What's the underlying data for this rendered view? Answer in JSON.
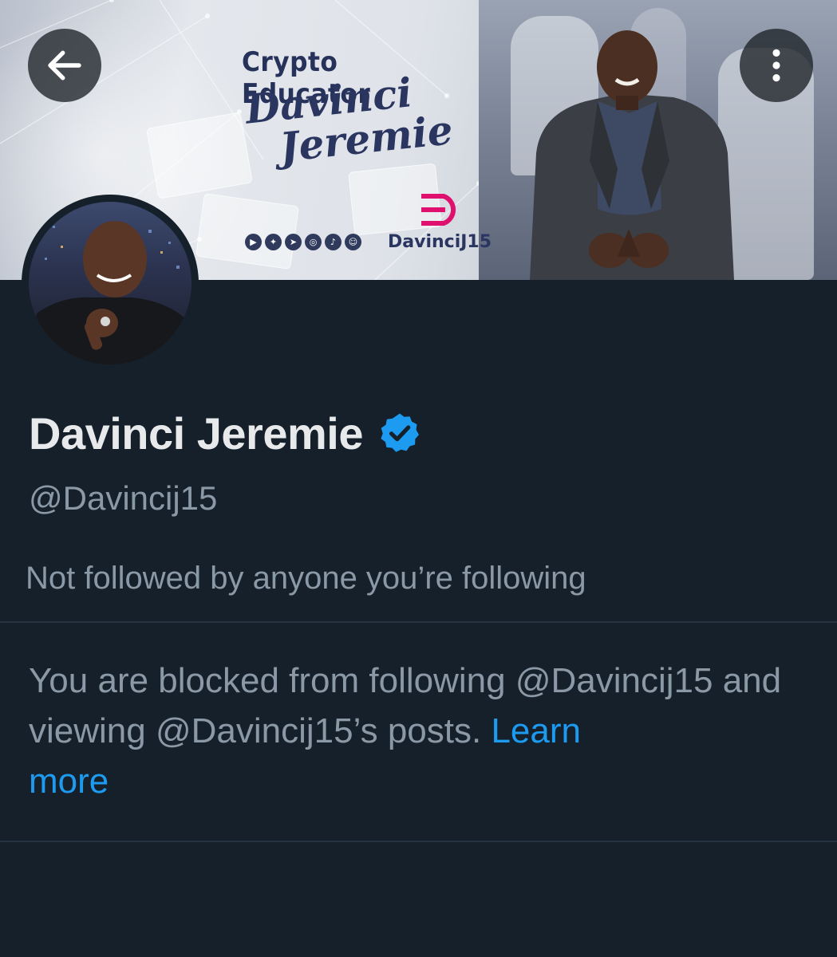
{
  "banner": {
    "title": "Crypto Educator",
    "script_line1": "Davinci",
    "script_line2": "Jeremie",
    "handle": "DavinciJ15",
    "social_icons": [
      "youtube-icon",
      "twitter-icon",
      "telegram-icon",
      "instagram-icon",
      "tiktok-icon",
      "discord-icon"
    ]
  },
  "nav": {
    "back_icon": "arrow-left-icon",
    "more_icon": "more-vertical-icon"
  },
  "profile": {
    "display_name": "Davinci Jeremie",
    "verified": true,
    "handle": "@Davincij15",
    "followed_by_text": "Not followed by anyone you’re following"
  },
  "blocked": {
    "message": "You are blocked from following @Davincij15 and viewing @Davincij15’s posts.",
    "link_label_1": "Learn",
    "link_label_2": "more"
  },
  "colors": {
    "background": "#15202b",
    "primary_text": "#e7e9ea",
    "secondary_text": "#8b98a5",
    "link": "#1d9bf0",
    "verified_badge": "#1d9bf0",
    "divider": "#25323f"
  }
}
